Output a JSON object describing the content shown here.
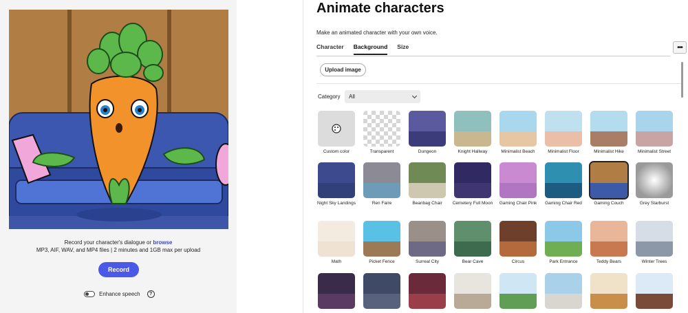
{
  "left": {
    "record_prefix": "Record your character's dialogue or",
    "browse_link": "browse",
    "formats": "MP3, AIF, WAV, and MP4 files | 2 minutes and 1GB max per upload",
    "record_button": "Record",
    "enhance_label": "Enhance speech",
    "help_glyph": "?"
  },
  "right": {
    "title": "Animate characters",
    "subtitle": "Make an animated character with your own voice.",
    "tabs": [
      {
        "label": "Character",
        "active": false
      },
      {
        "label": "Background",
        "active": true
      },
      {
        "label": "Size",
        "active": false
      }
    ],
    "more_glyph": "•••",
    "upload_button": "Upload image",
    "category_label": "Category",
    "category_value": "All",
    "backgrounds": [
      {
        "label": "Custom color",
        "colors": [
          "#dcdcdc",
          "#dcdcdc"
        ]
      },
      {
        "label": "Transparent",
        "colors": [
          "#ffffff",
          "#d6d6d6"
        ]
      },
      {
        "label": "Dungeon",
        "colors": [
          "#5b5a9e",
          "#3d3c7a"
        ]
      },
      {
        "label": "Knight Hallway",
        "colors": [
          "#8fc0bd",
          "#c9b88f"
        ]
      },
      {
        "label": "Minimalist Beach",
        "colors": [
          "#a9d8ee",
          "#e7c6a3"
        ]
      },
      {
        "label": "Minimalist Floor",
        "colors": [
          "#bfe0ef",
          "#ebbfa7"
        ]
      },
      {
        "label": "Minimalist Hike",
        "colors": [
          "#b3dcee",
          "#a97d66"
        ]
      },
      {
        "label": "Minimalist Street",
        "colors": [
          "#a8d5ec",
          "#c9a4a4"
        ]
      },
      {
        "label": "Night Sky Landings",
        "colors": [
          "#3d4b8e",
          "#32407a"
        ]
      },
      {
        "label": "Ren Faire",
        "colors": [
          "#8c8a94",
          "#6e9bb8"
        ]
      },
      {
        "label": "Beanbag Chair",
        "colors": [
          "#6f8a55",
          "#cfc8b0"
        ]
      },
      {
        "label": "Cemetery Full Moon",
        "colors": [
          "#312a62",
          "#3f3570"
        ]
      },
      {
        "label": "Gaming Chair Pink",
        "colors": [
          "#c98ad1",
          "#b076c2"
        ]
      },
      {
        "label": "Gaming Chair Red",
        "colors": [
          "#2f8fb0",
          "#1b5c80"
        ]
      },
      {
        "label": "Gaming Couch",
        "colors": [
          "#b07e45",
          "#3d5aa8"
        ]
      },
      {
        "label": "Grey Starburst",
        "colors": [
          "#ffffff",
          "#9a9a9a"
        ]
      },
      {
        "label": "Math",
        "colors": [
          "#f4ebe0",
          "#efe2d3"
        ]
      },
      {
        "label": "Picket Fence",
        "colors": [
          "#59c0e6",
          "#9c7a55"
        ]
      },
      {
        "label": "Surreal City",
        "colors": [
          "#9b8f8a",
          "#6e6a85"
        ]
      },
      {
        "label": "Bear Cave",
        "colors": [
          "#5f8f6c",
          "#3e6b4e"
        ]
      },
      {
        "label": "Circus",
        "colors": [
          "#6e3f2a",
          "#b56a3e"
        ]
      },
      {
        "label": "Park Entrance",
        "colors": [
          "#8cc9e8",
          "#6fae52"
        ]
      },
      {
        "label": "Teddy Bears",
        "colors": [
          "#e9b69a",
          "#c8794f"
        ]
      },
      {
        "label": "Winter Trees",
        "colors": [
          "#d7dde6",
          "#8c97a8"
        ]
      },
      {
        "label": "",
        "colors": [
          "#3a2b4a",
          "#5a3a62"
        ]
      },
      {
        "label": "",
        "colors": [
          "#3f4a66",
          "#58627d"
        ]
      },
      {
        "label": "",
        "colors": [
          "#6b2a3a",
          "#9a3f4a"
        ]
      },
      {
        "label": "",
        "colors": [
          "#e8e4de",
          "#b9aa98"
        ]
      },
      {
        "label": "",
        "colors": [
          "#cfe7f4",
          "#5f9e54"
        ]
      },
      {
        "label": "",
        "colors": [
          "#a9d1ea",
          "#d9d6d0"
        ]
      },
      {
        "label": "",
        "colors": [
          "#f0e2c8",
          "#c98f4a"
        ]
      },
      {
        "label": "",
        "colors": [
          "#dbeaf6",
          "#7b4b3a"
        ]
      }
    ]
  }
}
